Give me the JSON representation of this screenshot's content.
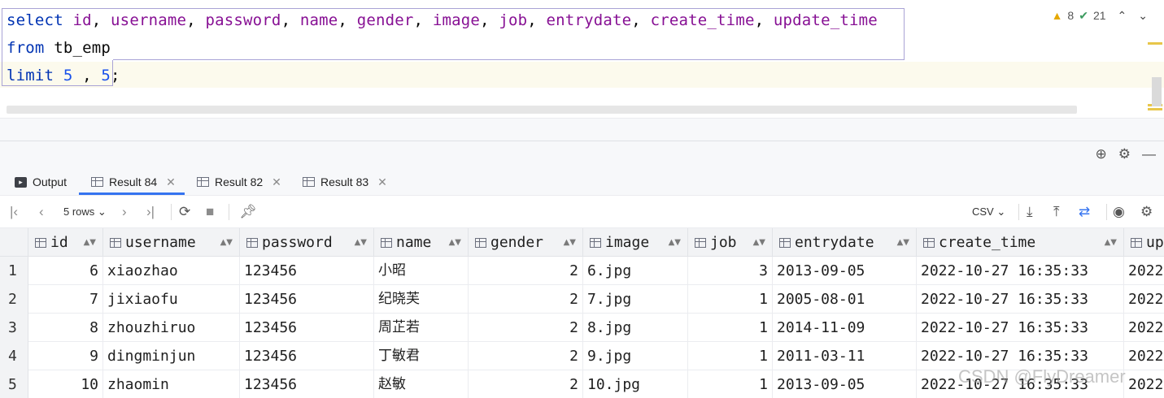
{
  "editor": {
    "line1": {
      "select": "select",
      "id": "id",
      "username": "username",
      "password": "password",
      "name": "name",
      "gender": "gender",
      "image": "image",
      "job": "job",
      "entrydate": "entrydate",
      "create_time": "create_time",
      "update_time": "update_time",
      "comma": ","
    },
    "line2": {
      "from": "from",
      "table": "tb_emp"
    },
    "line3": {
      "limit": "limit",
      "offset": "5",
      "comma": ",",
      "count": "5",
      "semicolon": ";"
    },
    "inspections": {
      "warnings": "8",
      "ok": "21"
    }
  },
  "tabs": [
    {
      "label": "Output"
    },
    {
      "label": "Result 84"
    },
    {
      "label": "Result 82"
    },
    {
      "label": "Result 83"
    }
  ],
  "toolbar": {
    "rows_label": "5 rows",
    "export_format": "CSV"
  },
  "grid": {
    "columns": [
      "id",
      "username",
      "password",
      "name",
      "gender",
      "image",
      "job",
      "entrydate",
      "create_time",
      "up"
    ],
    "rows": [
      {
        "rownum": "1",
        "id": "6",
        "username": "xiaozhao",
        "password": "123456",
        "name": "小昭",
        "gender": "2",
        "image": "6.jpg",
        "job": "3",
        "entrydate": "2013-09-05",
        "create_time": "2022-10-27 16:35:33",
        "update_time": "2022"
      },
      {
        "rownum": "2",
        "id": "7",
        "username": "jixiaofu",
        "password": "123456",
        "name": "纪晓芙",
        "gender": "2",
        "image": "7.jpg",
        "job": "1",
        "entrydate": "2005-08-01",
        "create_time": "2022-10-27 16:35:33",
        "update_time": "2022"
      },
      {
        "rownum": "3",
        "id": "8",
        "username": "zhouzhiruo",
        "password": "123456",
        "name": "周芷若",
        "gender": "2",
        "image": "8.jpg",
        "job": "1",
        "entrydate": "2014-11-09",
        "create_time": "2022-10-27 16:35:33",
        "update_time": "2022"
      },
      {
        "rownum": "4",
        "id": "9",
        "username": "dingminjun",
        "password": "123456",
        "name": "丁敏君",
        "gender": "2",
        "image": "9.jpg",
        "job": "1",
        "entrydate": "2011-03-11",
        "create_time": "2022-10-27 16:35:33",
        "update_time": "2022"
      },
      {
        "rownum": "5",
        "id": "10",
        "username": "zhaomin",
        "password": "123456",
        "name": "赵敏",
        "gender": "2",
        "image": "10.jpg",
        "job": "1",
        "entrydate": "2013-09-05",
        "create_time": "2022-10-27 16:35:33",
        "update_time": "2022"
      }
    ]
  },
  "watermark": "CSDN @FlyDreamer"
}
